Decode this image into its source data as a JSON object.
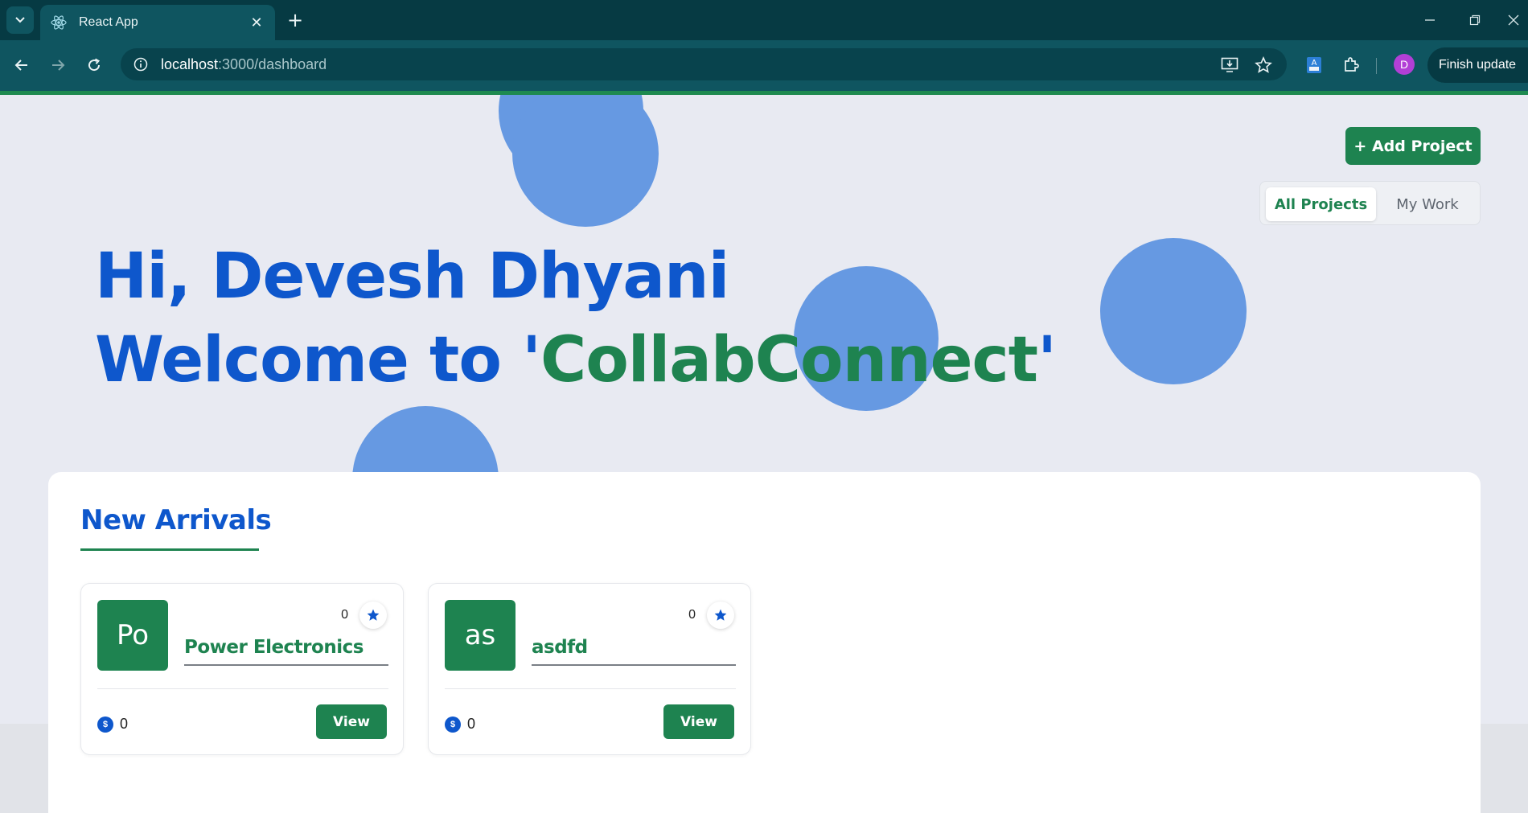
{
  "browser": {
    "tab_title": "React App",
    "url_host": "localhost",
    "url_path": ":3000/dashboard",
    "finish_update_label": "Finish update",
    "profile_initial": "D"
  },
  "header": {
    "add_project_label": "+ Add Project",
    "tabs": [
      {
        "label": "All Projects",
        "active": true
      },
      {
        "label": "My Work",
        "active": false
      }
    ]
  },
  "hero": {
    "greeting": "Hi, Devesh Dhyani",
    "welcome_prefix": "Welcome to '",
    "brand": "CollabConnect",
    "welcome_suffix": "'"
  },
  "section": {
    "title": "New Arrivals"
  },
  "projects": [
    {
      "initials": "Po",
      "title": "Power Electronics",
      "stars": "0",
      "coins": "0",
      "view_label": "View"
    },
    {
      "initials": "as",
      "title": "asdfd",
      "stars": "0",
      "coins": "0",
      "view_label": "View"
    }
  ],
  "colors": {
    "primary_blue": "#0e57cc",
    "brand_green": "#1e8350",
    "bubble_blue": "#6699e2",
    "chrome_dark": "#063a43",
    "chrome_toolbar": "#0f5560"
  }
}
